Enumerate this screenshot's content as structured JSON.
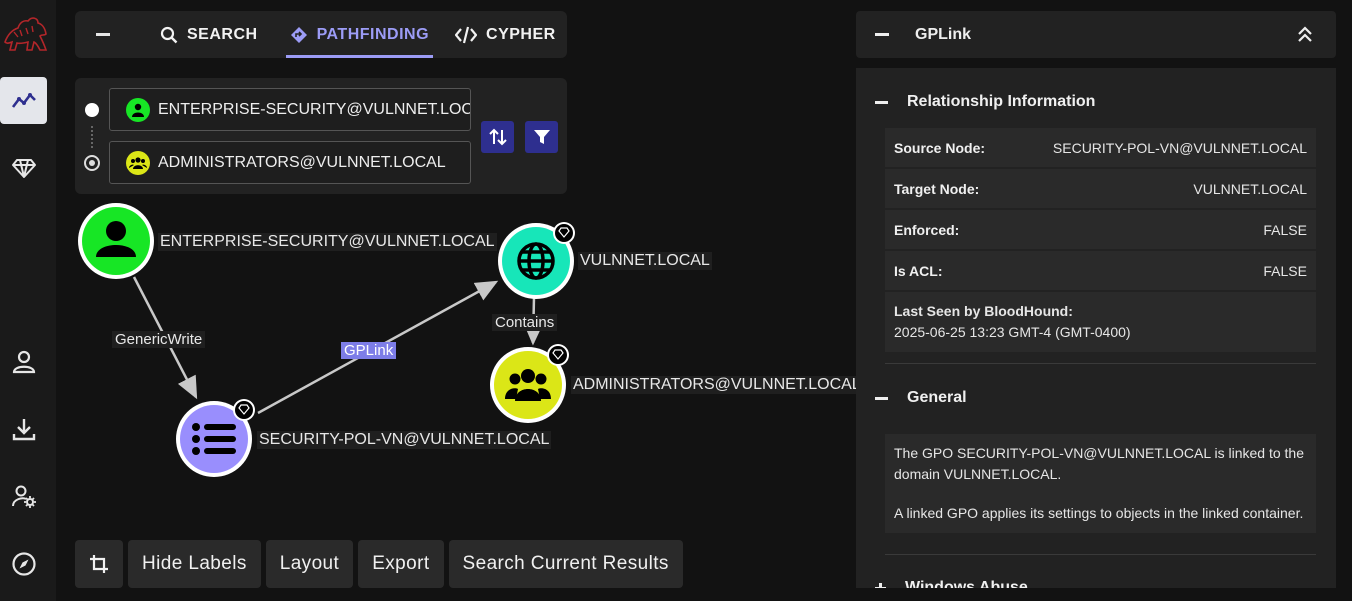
{
  "nav": {
    "items": [
      {
        "name": "explore",
        "icon": "graph-line-icon",
        "active": true
      },
      {
        "name": "group-management",
        "icon": "gem-icon",
        "active": false
      },
      {
        "name": "profile",
        "icon": "user-icon",
        "active": false
      },
      {
        "name": "download-collectors",
        "icon": "download-icon",
        "active": false
      },
      {
        "name": "administration",
        "icon": "user-gear-icon",
        "active": false
      },
      {
        "name": "api-explorer",
        "icon": "compass-icon",
        "active": false
      }
    ]
  },
  "modebar": {
    "tabs": [
      {
        "label": "SEARCH",
        "icon": "search-icon"
      },
      {
        "label": "PATHFINDING",
        "icon": "path-diamond-icon",
        "active": true
      },
      {
        "label": "CYPHER",
        "icon": "code-icon"
      }
    ]
  },
  "pathfinding": {
    "source_value": "ENTERPRISE-SECURITY@VULNNET.LOCAL",
    "target_value": "ADMINISTRATORS@VULNNET.LOCAL"
  },
  "toolbar": {
    "hide_labels": "Hide Labels",
    "layout": "Layout",
    "export": "Export",
    "search_current": "Search Current Results"
  },
  "graph": {
    "nodes": [
      {
        "label": "ENTERPRISE-SECURITY@VULNNET.LOCAL",
        "type": "user",
        "color": "#17e625"
      },
      {
        "label": "VULNNET.LOCAL",
        "type": "domain",
        "color": "#17e6b9"
      },
      {
        "label": "ADMINISTRATORS@VULNNET.LOCAL",
        "type": "group",
        "color": "#dbe617"
      },
      {
        "label": "SECURITY-POL-VN@VULNNET.LOCAL",
        "type": "gpo",
        "color": "#998efd"
      }
    ],
    "edges": [
      {
        "label": "GenericWrite"
      },
      {
        "label": "GPLink",
        "highlighted": true
      },
      {
        "label": "Contains"
      }
    ]
  },
  "panel": {
    "title": "GPLink",
    "relationship": {
      "heading": "Relationship Information",
      "rows": [
        {
          "key": "Source Node:",
          "value": "SECURITY-POL-VN@VULNNET.LOCAL"
        },
        {
          "key": "Target Node:",
          "value": "VULNNET.LOCAL"
        },
        {
          "key": "Enforced:",
          "value": "FALSE"
        },
        {
          "key": "Is ACL:",
          "value": "FALSE"
        }
      ],
      "last_seen_key": "Last Seen by BloodHound:",
      "last_seen_value": "2025-06-25 13:23 GMT-4 (GMT-0400)"
    },
    "general": {
      "heading": "General",
      "paragraphs": [
        "The GPO SECURITY-POL-VN@VULNNET.LOCAL is linked to the domain VULNNET.LOCAL.",
        "A linked GPO applies its settings to objects in the linked container."
      ]
    },
    "next_section": "Windows Abuse"
  },
  "colors": {
    "accent": "#9c9cf6",
    "button": "#2e2f8f",
    "background": "#121212"
  }
}
